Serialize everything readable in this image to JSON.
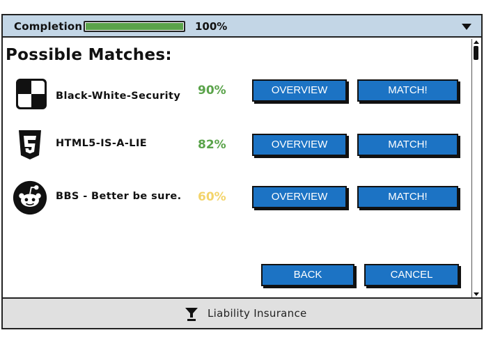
{
  "header": {
    "completion_label": "Completion:",
    "progress_fraction": 1.0,
    "progress_value": "100%"
  },
  "title": "Possible Matches:",
  "matches": [
    {
      "name": "Black-White-Security",
      "percent": "90%",
      "percent_color": "#5aa34a",
      "icon": "checkerboard-icon",
      "overview_label": "OVERVIEW",
      "match_label": "MATCH!"
    },
    {
      "name": "HTML5-IS-A-LIE",
      "percent": "82%",
      "percent_color": "#5aa34a",
      "icon": "html5-icon",
      "overview_label": "OVERVIEW",
      "match_label": "MATCH!"
    },
    {
      "name": "BBS - Better be sure.",
      "percent": "60%",
      "percent_color": "#f3d46a",
      "icon": "reddit-icon",
      "overview_label": "OVERVIEW",
      "match_label": "MATCH!"
    }
  ],
  "actions": {
    "back_label": "BACK",
    "cancel_label": "CANCEL"
  },
  "footer": {
    "icon": "funnel-icon",
    "label": "Liability Insurance"
  },
  "colors": {
    "topbar": "#c3d6e6",
    "button": "#1c73c4",
    "progress": "#5aa34a",
    "footer": "#e0e0e0"
  }
}
